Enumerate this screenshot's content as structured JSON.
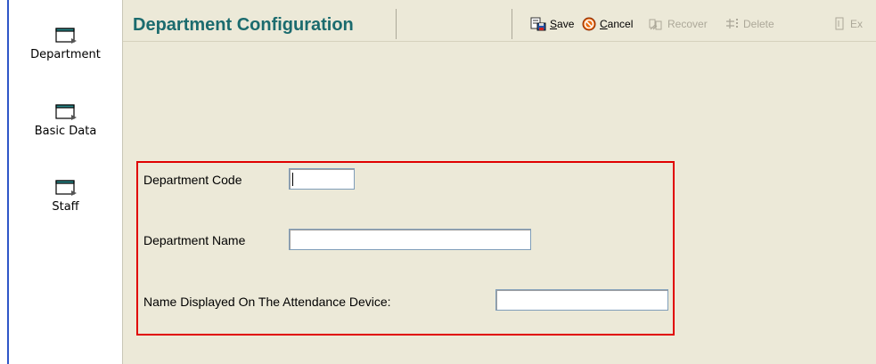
{
  "sidebar": {
    "items": [
      {
        "label": "Department",
        "icon": "window-icon"
      },
      {
        "label": "Basic Data",
        "icon": "window-icon"
      },
      {
        "label": "Staff",
        "icon": "window-icon"
      }
    ]
  },
  "header": {
    "title": "Department Configuration"
  },
  "toolbar": {
    "save": {
      "accel": "S",
      "rest": "ave",
      "enabled": true,
      "icon": "save-icon"
    },
    "cancel": {
      "accel": "C",
      "rest": "ancel",
      "enabled": true,
      "icon": "cancel-icon"
    },
    "recover": {
      "label": "Recover",
      "enabled": false,
      "icon": "recover-icon"
    },
    "delete": {
      "label": "Delete",
      "enabled": false,
      "icon": "delete-icon"
    },
    "exit": {
      "label": "Ex",
      "enabled": false,
      "icon": "exit-icon"
    }
  },
  "form": {
    "department_code": {
      "label": "Department Code",
      "value": ""
    },
    "department_name": {
      "label": "Department Name",
      "value": ""
    },
    "device_name": {
      "label": "Name Displayed On The Attendance Device:",
      "value": ""
    }
  },
  "colors": {
    "title": "#1b6b6e",
    "panel_bg": "#ece9d8",
    "highlight_border": "#e00000",
    "left_rule": "#2f56c8"
  }
}
